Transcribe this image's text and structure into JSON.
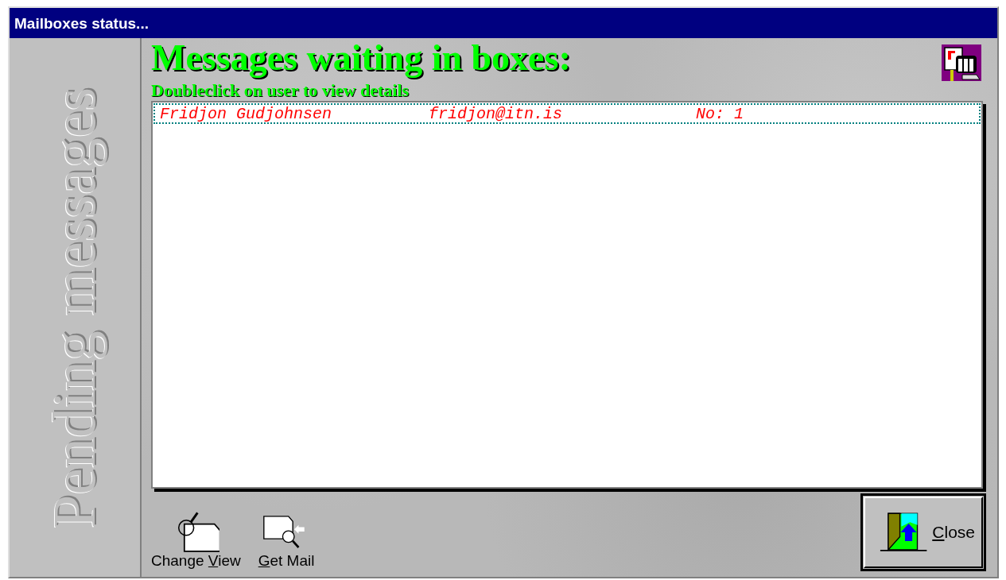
{
  "window": {
    "title": "Mailboxes status..."
  },
  "side_banner": {
    "text": "Pending messages"
  },
  "heading": "Messages waiting in boxes:",
  "subheading": "Doubleclick on user to view details",
  "list": {
    "rows": [
      {
        "name": "Fridjon Gudjohnsen",
        "email": "fridjon@itn.is",
        "count": "No: 1",
        "selected": true
      }
    ]
  },
  "toolbar": [
    {
      "kind": "change-view",
      "label_parts": [
        {
          "text": "Change "
        },
        {
          "text": "V",
          "underlined": true
        },
        {
          "text": "iew"
        }
      ]
    },
    {
      "kind": "get-mail",
      "label_parts": [
        {
          "text": "G",
          "underlined": true
        },
        {
          "text": "et Mail"
        }
      ]
    }
  ],
  "close_button": {
    "label_parts": [
      {
        "text": "C",
        "underlined": true
      },
      {
        "text": "lose"
      }
    ]
  }
}
